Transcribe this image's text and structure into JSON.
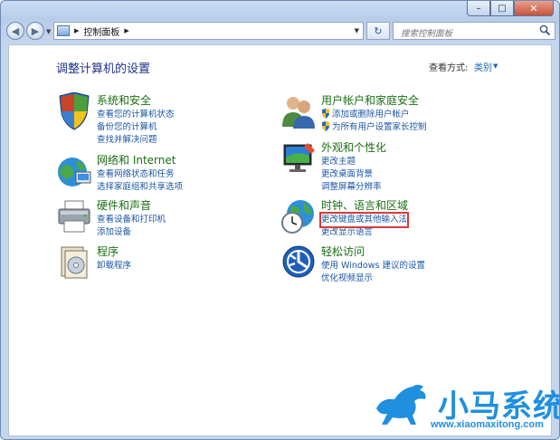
{
  "window": {
    "min_glyph": "–",
    "max_glyph": "□",
    "close_glyph": "✕"
  },
  "address": {
    "crumb": "控制面板"
  },
  "search": {
    "placeholder": "搜索控制面板"
  },
  "page_title": "调整计算机的设置",
  "view_by": {
    "label": "查看方式:",
    "value": "类别"
  },
  "categories": [
    {
      "title": "系统和安全",
      "icon": "system-security-icon",
      "links": [
        "查看您的计算机状态",
        "备份您的计算机",
        "查找并解决问题"
      ]
    },
    {
      "title": "网络和 Internet",
      "icon": "network-icon",
      "links": [
        "查看网络状态和任务",
        "选择家庭组和共享选项"
      ]
    },
    {
      "title": "硬件和声音",
      "icon": "printer-icon",
      "links": [
        "查看设备和打印机",
        "添加设备"
      ]
    },
    {
      "title": "程序",
      "icon": "programs-icon",
      "links": [
        "卸载程序"
      ]
    },
    {
      "title": "用户帐户和家庭安全",
      "icon": "users-icon",
      "links": [
        "添加或删除用户帐户",
        "为所有用户设置家长控制"
      ]
    },
    {
      "title": "外观和个性化",
      "icon": "appearance-icon",
      "links": [
        "更改主题",
        "更改桌面背景",
        "调整屏幕分辨率"
      ]
    },
    {
      "title": "时钟、语言和区域",
      "icon": "clock-globe-icon",
      "links": [
        "更改键盘或其他输入法",
        "更改显示语言"
      ]
    },
    {
      "title": "轻松访问",
      "icon": "ease-of-access-icon",
      "links": [
        "使用 Windows 建议的设置",
        "优化视频显示"
      ]
    }
  ],
  "watermark": {
    "brand": "小马系统",
    "url": "www.xiaomaxitong.com"
  },
  "colors": {
    "title_green": "#1b6e13",
    "link_blue": "#1a55a8",
    "highlight_red": "#d83a3a"
  }
}
